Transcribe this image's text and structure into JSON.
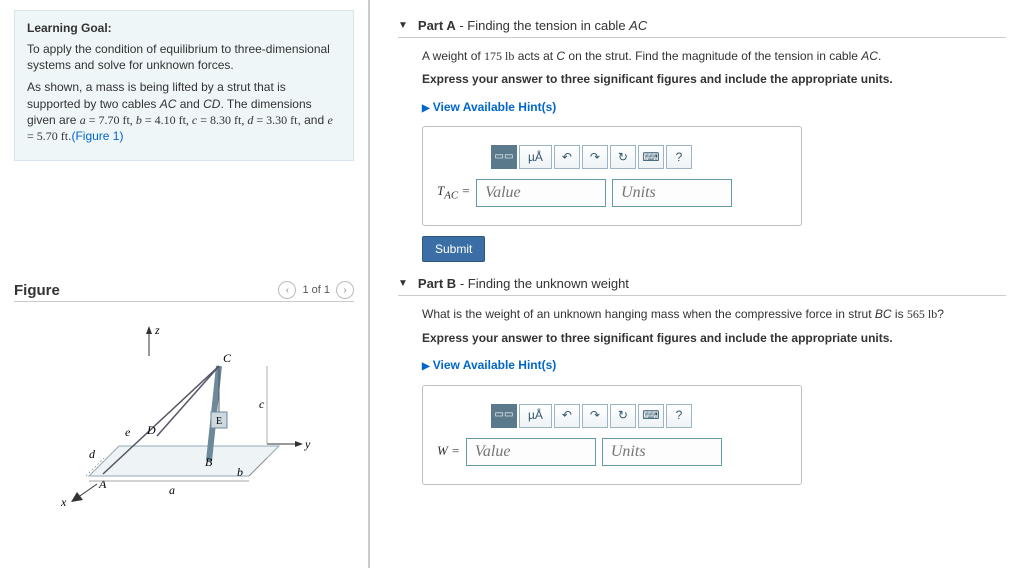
{
  "goal": {
    "heading": "Learning Goal:",
    "p1": "To apply the condition of equilibrium to three-dimensional systems and solve for unknown forces.",
    "p2_prefix": "As shown, a mass is being lifted by a strut that is supported by two cables ",
    "p2_ac": "AC",
    "p2_and": " and ",
    "p2_cd": "CD",
    "p2_mid": ". The dimensions given are ",
    "dim_a": "a = 7.70 ft",
    "dim_b": "b = 4.10 ft",
    "dim_c": "c = 8.30 ft",
    "dim_d": "d = 3.30 ft",
    "dim_e": "e = 5.70 ft",
    "fig_link": "(Figure 1)"
  },
  "figure": {
    "title": "Figure",
    "page": "1 of 1",
    "labels": {
      "z": "z",
      "y": "y",
      "x": "x",
      "A": "A",
      "B": "B",
      "C": "C",
      "D": "D",
      "E": "E",
      "a": "a",
      "b": "b",
      "c": "c",
      "d": "d",
      "e": "e"
    }
  },
  "partA": {
    "title_bold": "Part A",
    "title_rest": " - Finding the tension in cable ",
    "title_var": "AC",
    "q_prefix": "A weight of ",
    "weight": "175 lb",
    "q_mid": " acts at ",
    "pointC": "C",
    "q_mid2": " on the strut. Find the magnitude of the tension in cable ",
    "q_var": "AC",
    "q_end": ".",
    "instr": "Express your answer to three significant figures and include the appropriate units.",
    "hints": "View Available Hint(s)",
    "label_html": "T",
    "label_sub": "AC",
    "eq": " =",
    "val_ph": "Value",
    "unit_ph": "Units",
    "submit": "Submit"
  },
  "partB": {
    "title_bold": "Part B",
    "title_rest": " - Finding the unknown weight",
    "q_prefix": "What is the weight of an unknown hanging mass when the compressive force in strut ",
    "strut": "BC",
    "q_mid": " is  ",
    "force": "565 lb",
    "q_end": "?",
    "instr": "Express your answer to three significant figures and include the appropriate units.",
    "hints": "View Available Hint(s)",
    "label": "W",
    "eq": " =",
    "val_ph": "Value",
    "unit_ph": "Units"
  },
  "toolbar": {
    "templates": "▭▭",
    "units": "µÅ",
    "undo": "↶",
    "redo": "↷",
    "reset": "↻",
    "keyboard": "⌨",
    "help": "?"
  }
}
